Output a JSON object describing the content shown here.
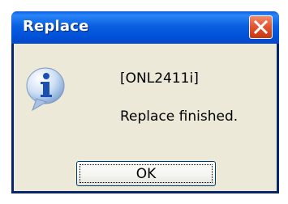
{
  "dialog": {
    "title": "Replace",
    "close_icon": "close-icon",
    "message_icon": "info-icon",
    "message_id": "[ONL2411i]",
    "message": "Replace finished.",
    "ok_label": "OK"
  },
  "colors": {
    "titlebar": "#0a5fe0",
    "close_button": "#e2522d",
    "client_background": "#ece9d8",
    "button_border": "#003c74"
  }
}
